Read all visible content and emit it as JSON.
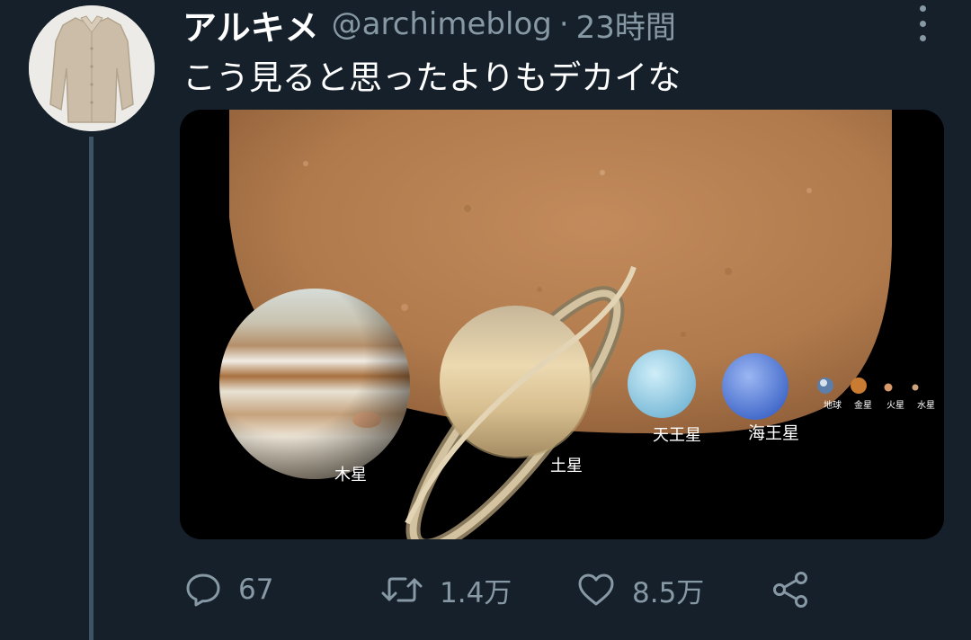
{
  "tweet": {
    "display_name": "アルキメ",
    "handle": "@archimeblog",
    "separator": "·",
    "time": "23時間",
    "text": "こう見ると思ったよりもデカイな"
  },
  "media": {
    "labels": {
      "jupiter": "木星",
      "saturn": "土星",
      "uranus": "天王星",
      "neptune": "海王星",
      "earth": "地球",
      "venus": "金星",
      "mars": "火星",
      "mercury": "水星"
    }
  },
  "actions": {
    "reply_count": "67",
    "retweet_count": "1.4万",
    "like_count": "8.5万"
  },
  "icons": {
    "more": "more-vertical-icon",
    "reply": "reply-icon",
    "retweet": "retweet-icon",
    "like": "heart-icon",
    "share": "share-icon"
  },
  "colors": {
    "background": "#15202b",
    "secondary_text": "#8899a6",
    "thread_line": "#3d5466"
  }
}
